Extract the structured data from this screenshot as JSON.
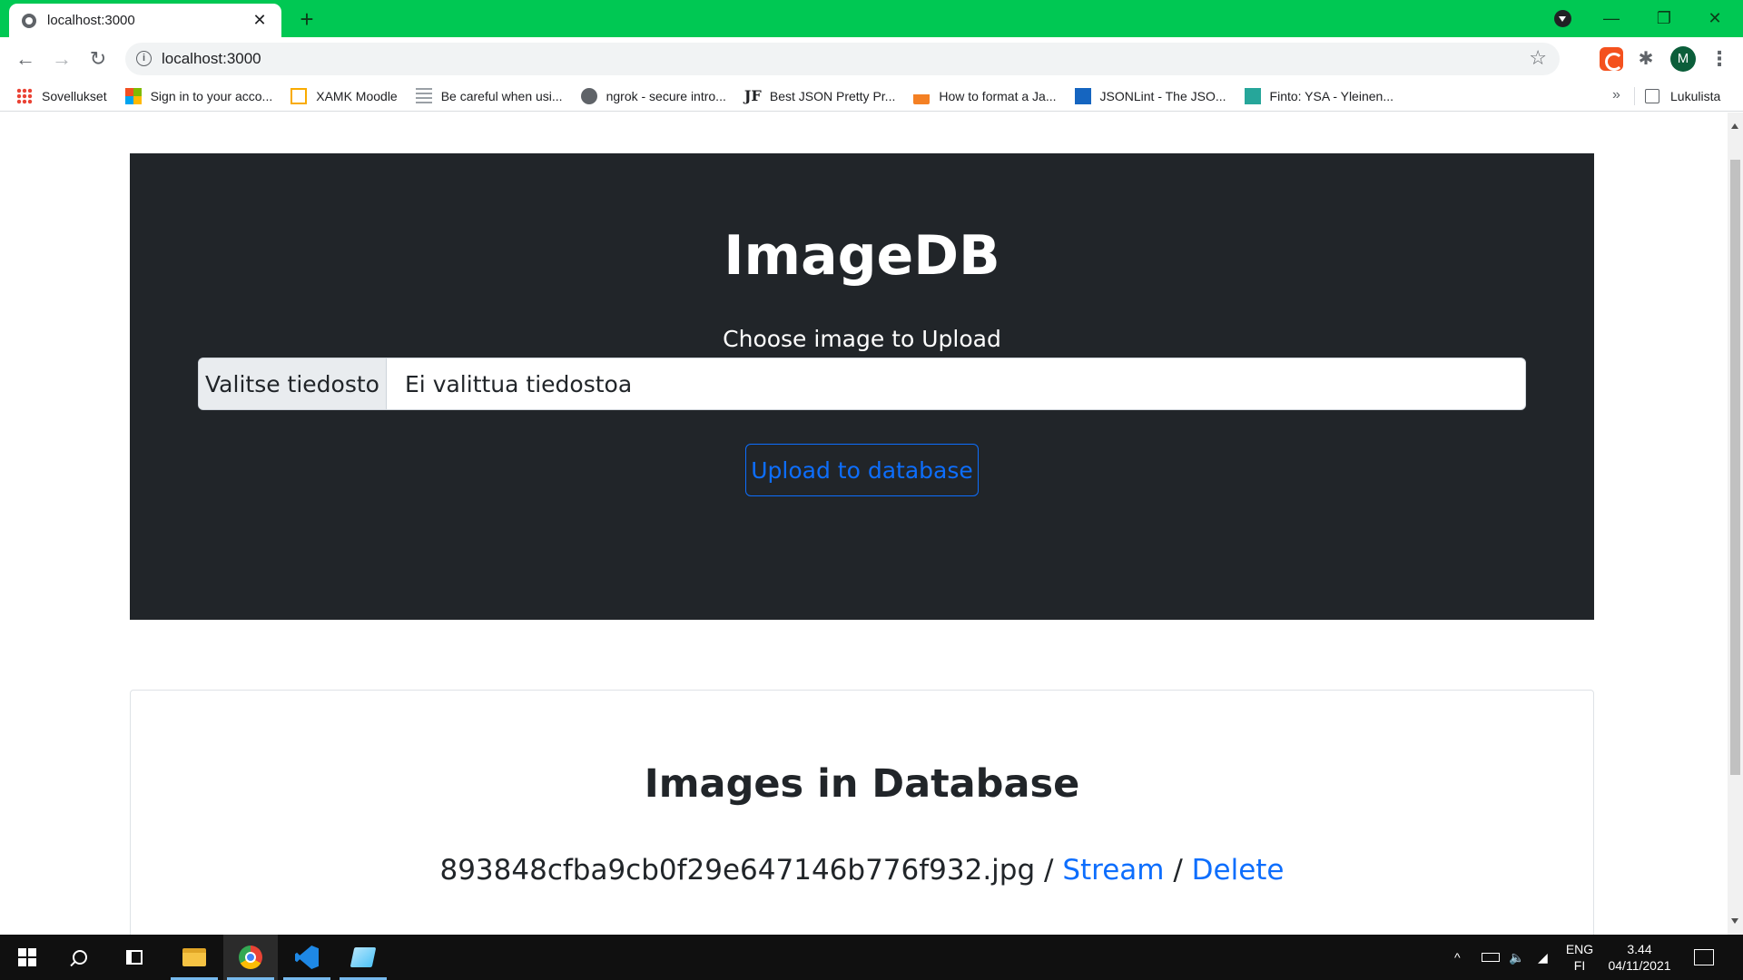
{
  "browser": {
    "tab_title": "localhost:3000",
    "tab_close": "✕",
    "new_tab": "+",
    "url": "localhost:3000",
    "profile_initial": "M",
    "window_controls": {
      "minimize": "—",
      "restore": "❐",
      "close": "✕"
    }
  },
  "bookmarks": {
    "items": [
      {
        "label": "Sovellukset",
        "icon": "apps-grid-icon"
      },
      {
        "label": "Sign in to your acco...",
        "icon": "microsoft-icon"
      },
      {
        "label": "XAMK Moodle",
        "icon": "moodle-icon"
      },
      {
        "label": "Be careful when usi...",
        "icon": "lines-icon"
      },
      {
        "label": "ngrok - secure intro...",
        "icon": "globe-icon"
      },
      {
        "label": "Best JSON Pretty Pr...",
        "icon": "jf-icon"
      },
      {
        "label": "How to format a Ja...",
        "icon": "stackoverflow-icon"
      },
      {
        "label": "JSONLint - The JSO...",
        "icon": "jsonlint-icon"
      },
      {
        "label": "Finto: YSA - Yleinen...",
        "icon": "finto-icon"
      }
    ],
    "more": "»",
    "reading_list": "Lukulista"
  },
  "page": {
    "hero": {
      "title": "ImageDB",
      "label": "Choose image to Upload",
      "file_button": "Valitse tiedosto",
      "file_status": "Ei valittua tiedostoa",
      "upload_button": "Upload to database"
    },
    "images": {
      "title": "Images in Database",
      "entries": [
        {
          "filename": "893848cfba9cb0f29e647146b776f932.jpg",
          "sep1": " / ",
          "stream": "Stream",
          "sep2": " / ",
          "delete": "Delete"
        }
      ]
    }
  },
  "taskbar": {
    "lang_top": "ENG",
    "lang_bottom": "FI",
    "time": "3.44",
    "date": "04/11/2021",
    "tray_chevron": "^"
  },
  "colors": {
    "titlebar": "#00c853",
    "hero_bg": "#212529",
    "link": "#0d6efd"
  }
}
